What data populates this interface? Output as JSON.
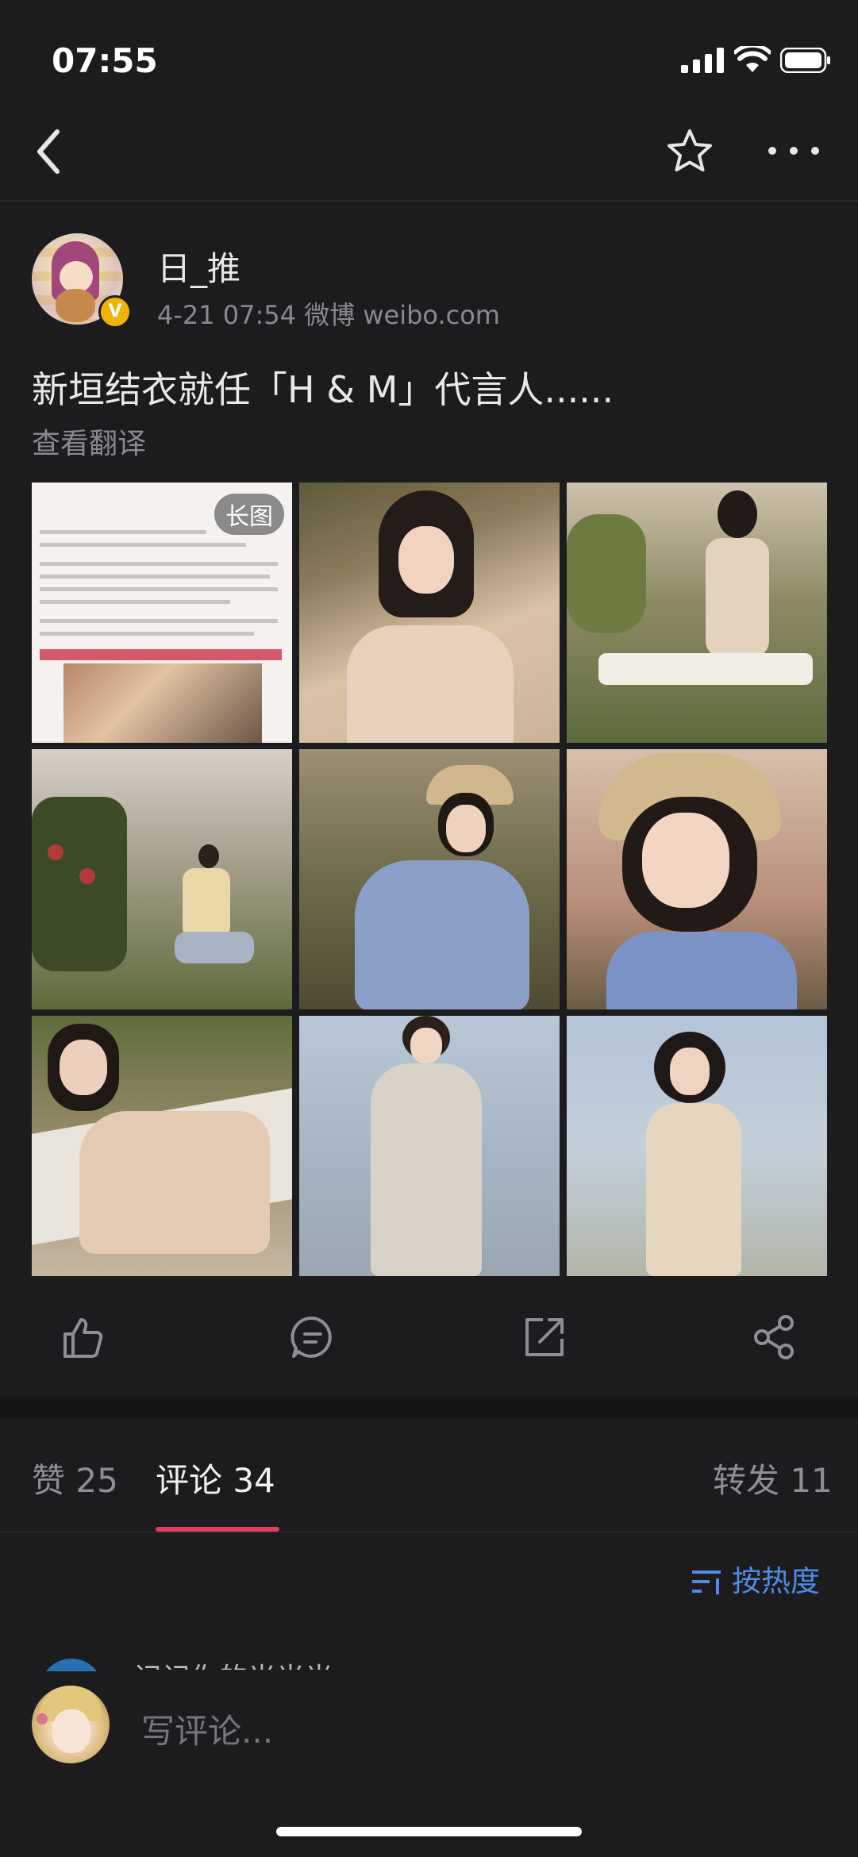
{
  "status": {
    "time": "07:55"
  },
  "post": {
    "username": "日_推",
    "meta": "4-21 07:54   微博 weibo.com",
    "text": "新垣结衣就任「H & M」代言人......",
    "translate": "查看翻译",
    "long_image_badge": "长图"
  },
  "tabs": [
    {
      "label": "赞 25"
    },
    {
      "label": "评论 34"
    },
    {
      "label": "转发 11"
    }
  ],
  "sort_label": "按热度",
  "peek_name": "记记你的光光光",
  "input_placeholder": "写评论...",
  "icons": [
    "back-icon",
    "star-icon",
    "more-icon",
    "like-icon",
    "comment-icon",
    "repost-icon",
    "share-icon",
    "sort-icon"
  ],
  "colors": {
    "accent": "#e0405e",
    "link": "#4f8ce6",
    "background": "#1c1c1e"
  }
}
